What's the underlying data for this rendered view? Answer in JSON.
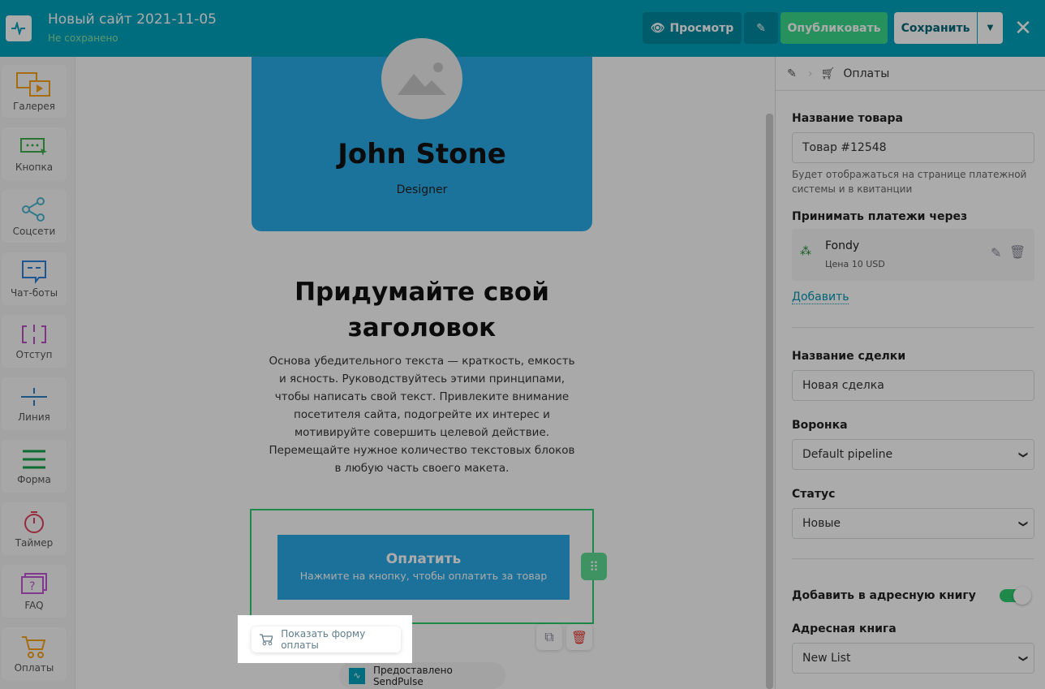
{
  "header": {
    "title": "Новый сайт 2021-11-05",
    "status": "Не сохранено",
    "preview": "Просмотр",
    "publish": "Опубликовать",
    "save": "Сохранить"
  },
  "sidebar": {
    "items": [
      {
        "label": "Галерея"
      },
      {
        "label": "Кнопка"
      },
      {
        "label": "Соцсети"
      },
      {
        "label": "Чат-боты"
      },
      {
        "label": "Отступ"
      },
      {
        "label": "Линия"
      },
      {
        "label": "Форма"
      },
      {
        "label": "Таймер"
      },
      {
        "label": "FAQ"
      },
      {
        "label": "Оплаты"
      }
    ]
  },
  "canvas": {
    "name": "John Stone",
    "role": "Designer",
    "heading": "Придумайте свой заголовок",
    "body": "Основа убедительного текста — краткость, емкость и ясность. Руководствуйтесь этими принципами, чтобы написать свой текст. Привлеките внимание посетителя сайта, подогрейте их интерес и мотивируйте совершить целевой действие. Перемещайте нужное количество текстовых блоков в любую часть своего макета.",
    "pay_title": "Оплатить",
    "pay_sub": "Нажмите на кнопку, чтобы оплатить за товар",
    "show_form": "Показать форму оплаты",
    "powered": "Предоставлено SendPulse"
  },
  "panel": {
    "crumb": "Оплаты",
    "product_label": "Название товара",
    "product_value": "Товар #12548",
    "product_hint": "Будет отображаться на странице платежной системы и в квитанции",
    "accept_label": "Принимать платежи через",
    "provider": "Fondy",
    "price": "Цена 10 USD",
    "add": "Добавить",
    "deal_label": "Название сделки",
    "deal_value": "Новая сделка",
    "funnel_label": "Воронка",
    "funnel_value": "Default pipeline",
    "status_label": "Статус",
    "status_value": "Новые",
    "addbook_label": "Добавить в адресную книгу",
    "addbook_on": true,
    "book_label": "Адресная книга",
    "book_value": "New List"
  }
}
